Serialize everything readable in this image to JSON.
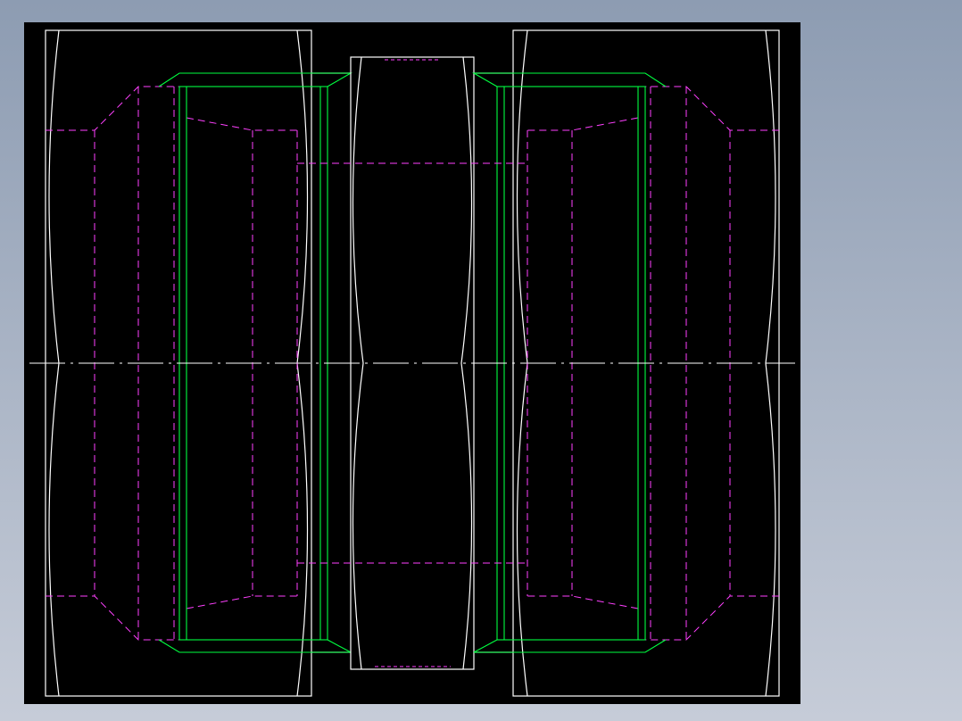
{
  "viewport": {
    "background_top": "#8d9cb2",
    "background_bottom": "#c6ccd8"
  },
  "drawing": {
    "sheet_color": "#000000",
    "outline_color": "#ffffff",
    "hidden_line_color": "#ff40ff",
    "green_line_color": "#00ff40",
    "center_line_color": "#ffffff",
    "views": [
      {
        "name": "left-end-fitting",
        "line_style": "solid"
      },
      {
        "name": "center-hex-nut",
        "line_style": "solid"
      },
      {
        "name": "right-end-fitting",
        "line_style": "solid"
      }
    ]
  }
}
